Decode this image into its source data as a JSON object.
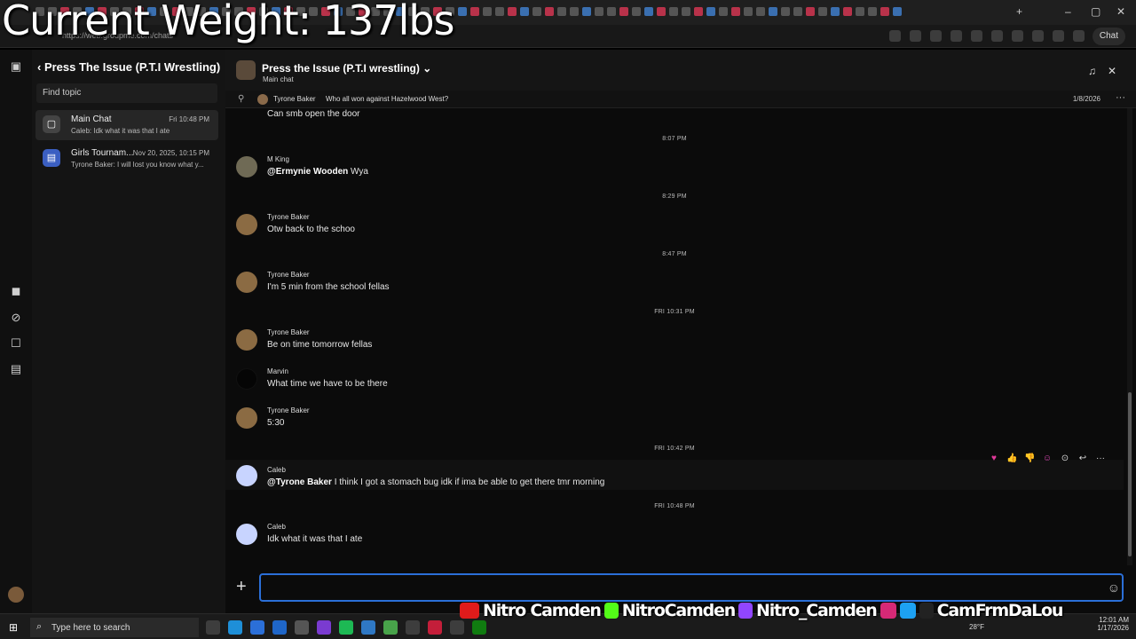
{
  "overlay": {
    "weight_text": "Current Weight: 137lbs",
    "socials": [
      "Nitro Camden",
      "NitroCamden",
      "Nitro_Camden",
      "CamFrmDaLou"
    ]
  },
  "browser": {
    "url": "https://web.groupme.com/chats",
    "chat_button": "Chat"
  },
  "topics_panel": {
    "back_title": "Press The Issue (P.T.I Wrestling)",
    "find_placeholder": "Find topic",
    "topics": [
      {
        "title": "Main Chat",
        "date": "Fri 10:48 PM",
        "preview": "Caleb: Idk what it was that I ate"
      },
      {
        "title": "Girls Tournam...",
        "date": "Nov 20, 2025, 10:15 PM",
        "preview": "Tyrone Baker: I will lost you know what y..."
      }
    ]
  },
  "chat": {
    "title": "Press the Issue (P.T.I wrestling)",
    "subtitle": "Main chat",
    "pinned": {
      "author": "Tyrone Baker",
      "text": "Who all won against Hazelwood West?",
      "date": "1/8/2026"
    },
    "top_partial_message": "Can smb open the door",
    "timestamps": [
      "8:07 PM",
      "8:29 PM",
      "8:47 PM",
      "FRI 10:31 PM",
      "FRI 10:42 PM",
      "FRI 10:48 PM"
    ],
    "messages": [
      {
        "author": "M King",
        "mention": "@Ermynie Wooden",
        "text": "Wya"
      },
      {
        "author": "Tyrone Baker",
        "mention": "",
        "text": "Otw back to the schoo"
      },
      {
        "author": "Tyrone Baker",
        "mention": "",
        "text": "I'm 5 min from the school fellas"
      },
      {
        "author": "Tyrone Baker",
        "mention": "",
        "text": "Be on time tomorrow fellas"
      },
      {
        "author": "Marvin",
        "mention": "",
        "text": "What time we have to be there"
      },
      {
        "author": "Tyrone Baker",
        "mention": "",
        "text": "5:30"
      },
      {
        "author": "Caleb",
        "mention": "@Tyrone Baker",
        "text": "I think I got a stomach bug idk if ima be able to get there tmr morning"
      },
      {
        "author": "Caleb",
        "mention": "",
        "text": "Idk what it was that I ate"
      }
    ],
    "composer_placeholder": ""
  },
  "taskbar": {
    "search_placeholder": "Type here to search",
    "temperature": "28°F",
    "time": "12:01 AM",
    "date": "1/17/2026"
  }
}
